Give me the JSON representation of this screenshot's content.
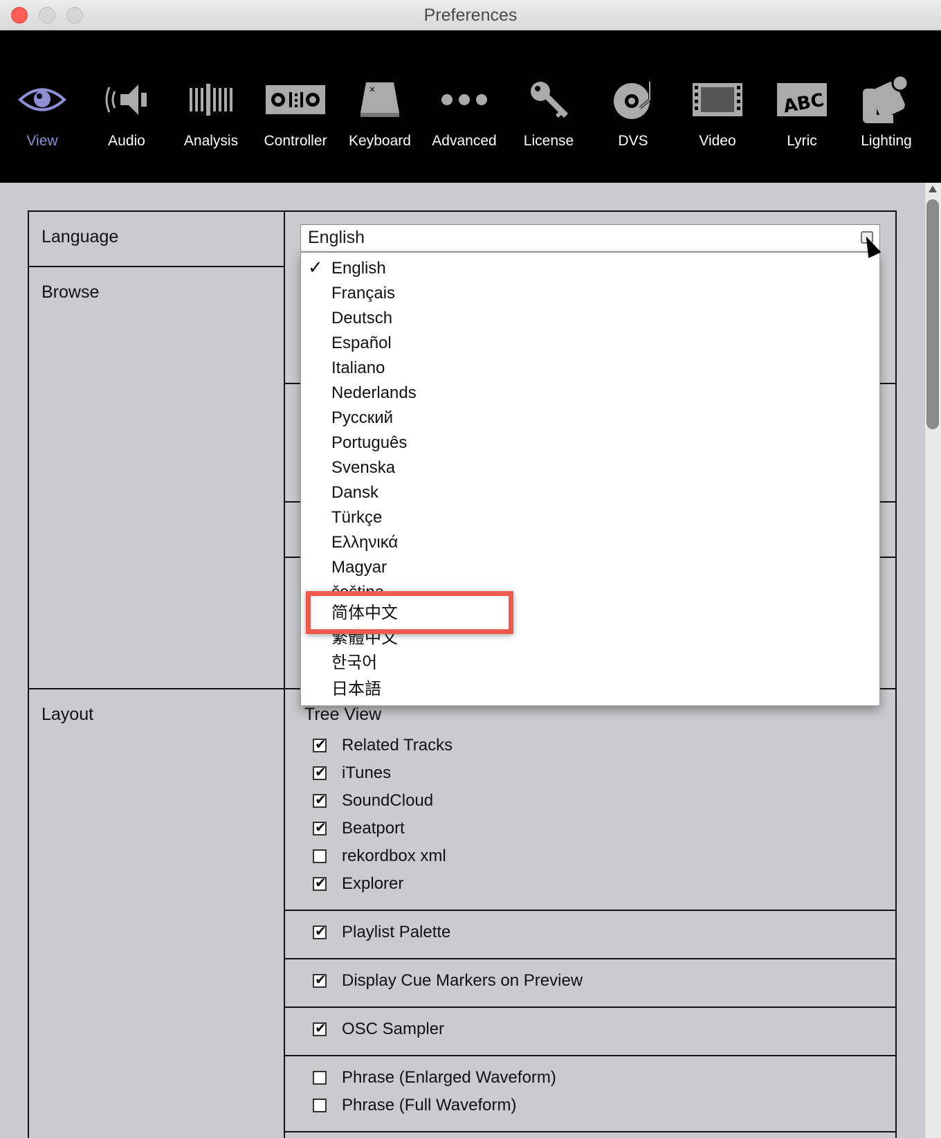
{
  "window": {
    "title": "Preferences"
  },
  "toolbar": {
    "items": [
      {
        "label": "View",
        "icon": "eye-icon",
        "active": true
      },
      {
        "label": "Audio",
        "icon": "speaker-icon",
        "active": false
      },
      {
        "label": "Analysis",
        "icon": "analysis-bars-icon",
        "active": false
      },
      {
        "label": "Controller",
        "icon": "controller-icon",
        "active": false
      },
      {
        "label": "Keyboard",
        "icon": "keyboard-key-icon",
        "active": false
      },
      {
        "label": "Advanced",
        "icon": "dots-icon",
        "active": false
      },
      {
        "label": "License",
        "icon": "key-icon",
        "active": false
      },
      {
        "label": "DVS",
        "icon": "turntable-icon",
        "active": false
      },
      {
        "label": "Video",
        "icon": "film-icon",
        "active": false
      },
      {
        "label": "Lyric",
        "icon": "abc-icon",
        "active": false
      },
      {
        "label": "Lighting",
        "icon": "light-fixture-icon",
        "active": false
      }
    ]
  },
  "rows": {
    "language": "Language",
    "browse": "Browse",
    "layout": "Layout"
  },
  "language": {
    "selected": "English",
    "options": [
      "English",
      "Français",
      "Deutsch",
      "Español",
      "Italiano",
      "Nederlands",
      "Русский",
      "Português",
      "Svenska",
      "Dansk",
      "Türkçe",
      "Ελληνικά",
      "Magyar",
      "čeština",
      "简体中文",
      "繁體中文",
      "한국어",
      "日本語"
    ]
  },
  "layout": {
    "tree_view": {
      "title": "Tree View",
      "items": [
        {
          "label": "Related Tracks",
          "checked": true
        },
        {
          "label": "iTunes",
          "checked": true
        },
        {
          "label": "SoundCloud",
          "checked": true
        },
        {
          "label": "Beatport",
          "checked": true
        },
        {
          "label": "rekordbox xml",
          "checked": false
        },
        {
          "label": "Explorer",
          "checked": true
        }
      ]
    },
    "playlist_palette": {
      "label": "Playlist Palette",
      "checked": true
    },
    "cue_markers": {
      "label": "Display Cue Markers on Preview",
      "checked": true
    },
    "osc_sampler": {
      "label": "OSC Sampler",
      "checked": true
    },
    "phrase_enlarged": {
      "label": "Phrase (Enlarged Waveform)",
      "checked": false
    },
    "phrase_full": {
      "label": "Phrase (Full Waveform)",
      "checked": false
    }
  },
  "colors": {
    "accent": "#8f8fd8",
    "highlight": "#ee5a4e"
  }
}
